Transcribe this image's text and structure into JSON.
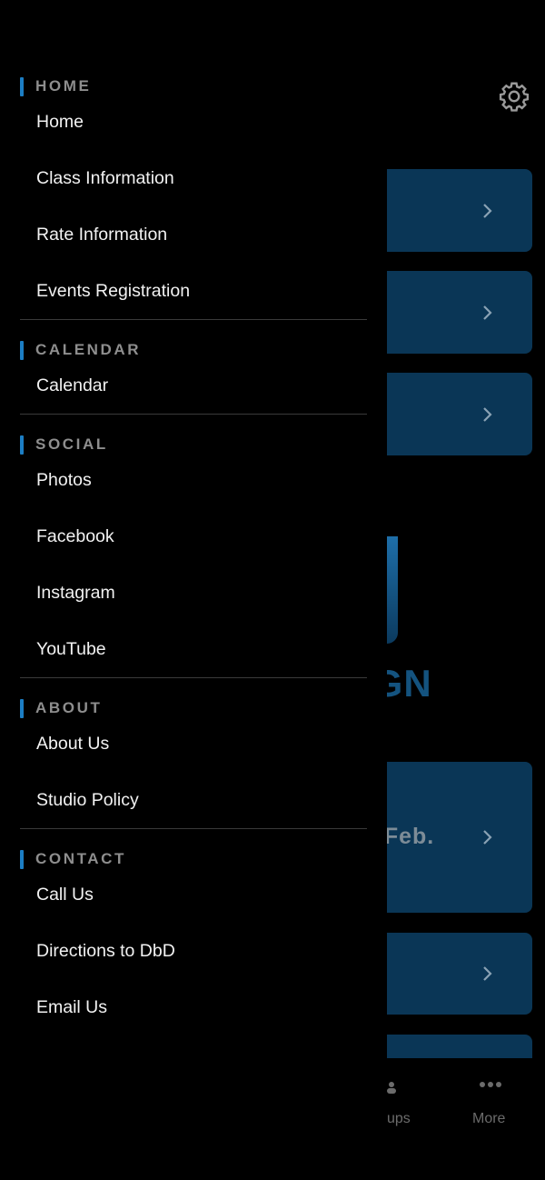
{
  "background": {
    "card_text": "s Feb.",
    "logo_text": "IGN",
    "tabbar": {
      "groups_label": "ups",
      "more_label": "More"
    }
  },
  "drawer": {
    "sections": [
      {
        "title": "HOME",
        "items": [
          "Home",
          "Class Information",
          "Rate Information",
          "Events Registration"
        ]
      },
      {
        "title": "CALENDAR",
        "items": [
          "Calendar"
        ]
      },
      {
        "title": "SOCIAL",
        "items": [
          "Photos",
          "Facebook",
          "Instagram",
          "YouTube"
        ]
      },
      {
        "title": "ABOUT",
        "items": [
          "About Us",
          "Studio Policy"
        ]
      },
      {
        "title": "CONTACT",
        "items": [
          "Call Us",
          "Directions to DbD",
          "Email Us"
        ]
      }
    ]
  },
  "colors": {
    "accent": "#1c7ec4",
    "card": "#0a3656",
    "section_title": "#8e8e8e",
    "item_text": "#f2f2f2"
  }
}
